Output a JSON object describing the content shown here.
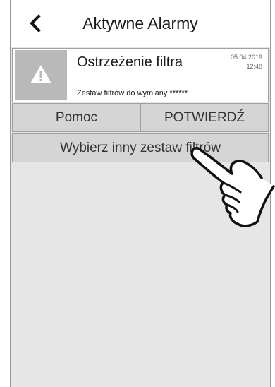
{
  "header": {
    "title": "Aktywne Alarmy",
    "back_icon": "chevron-left-icon"
  },
  "alarm": {
    "title": "Ostrzeżenie filtra",
    "date": "05.04.2019",
    "time": "12:48",
    "description": "Zestaw filtrów do wymiany ******",
    "icon": "warning-triangle-icon"
  },
  "actions": {
    "help_label": "Pomoc",
    "confirm_label": "POTWIERDŹ",
    "change_filter_label": "Wybierz inny zestaw filtrów"
  },
  "overlay": {
    "icon": "pointing-hand-icon"
  }
}
